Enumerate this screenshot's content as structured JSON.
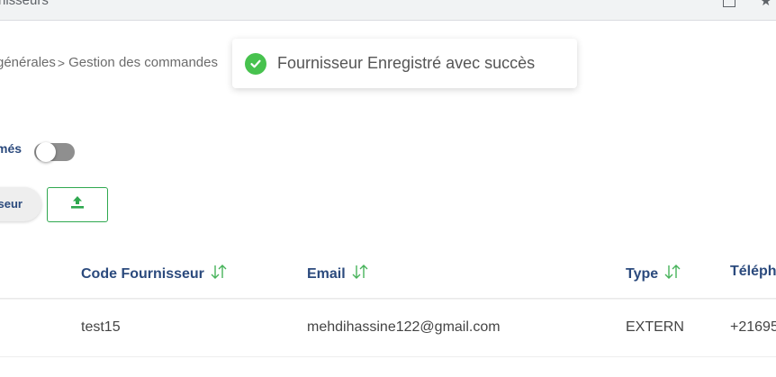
{
  "browser": {
    "tab_title": "nisseurs"
  },
  "breadcrumb": {
    "items": [
      "générales",
      "Gestion des commandes"
    ],
    "separator": ">"
  },
  "toast": {
    "message": "Fournisseur Enregistré avec succès",
    "icon": "check-circle-icon",
    "color": "#47c24e"
  },
  "filter": {
    "toggle_label": "més",
    "toggle_on": false
  },
  "actions": {
    "supplier_button_label": "seur",
    "upload_icon": "upload-icon"
  },
  "colors": {
    "header_text": "#2b4a7d",
    "accent_green": "#2fa84f"
  },
  "table": {
    "columns": [
      "Code Fournisseur",
      "Email",
      "Type",
      "Téléph"
    ],
    "rows": [
      {
        "code": "test15",
        "email": "mehdihassine122@gmail.com",
        "type": "EXTERN",
        "phone": "+21695"
      }
    ]
  }
}
